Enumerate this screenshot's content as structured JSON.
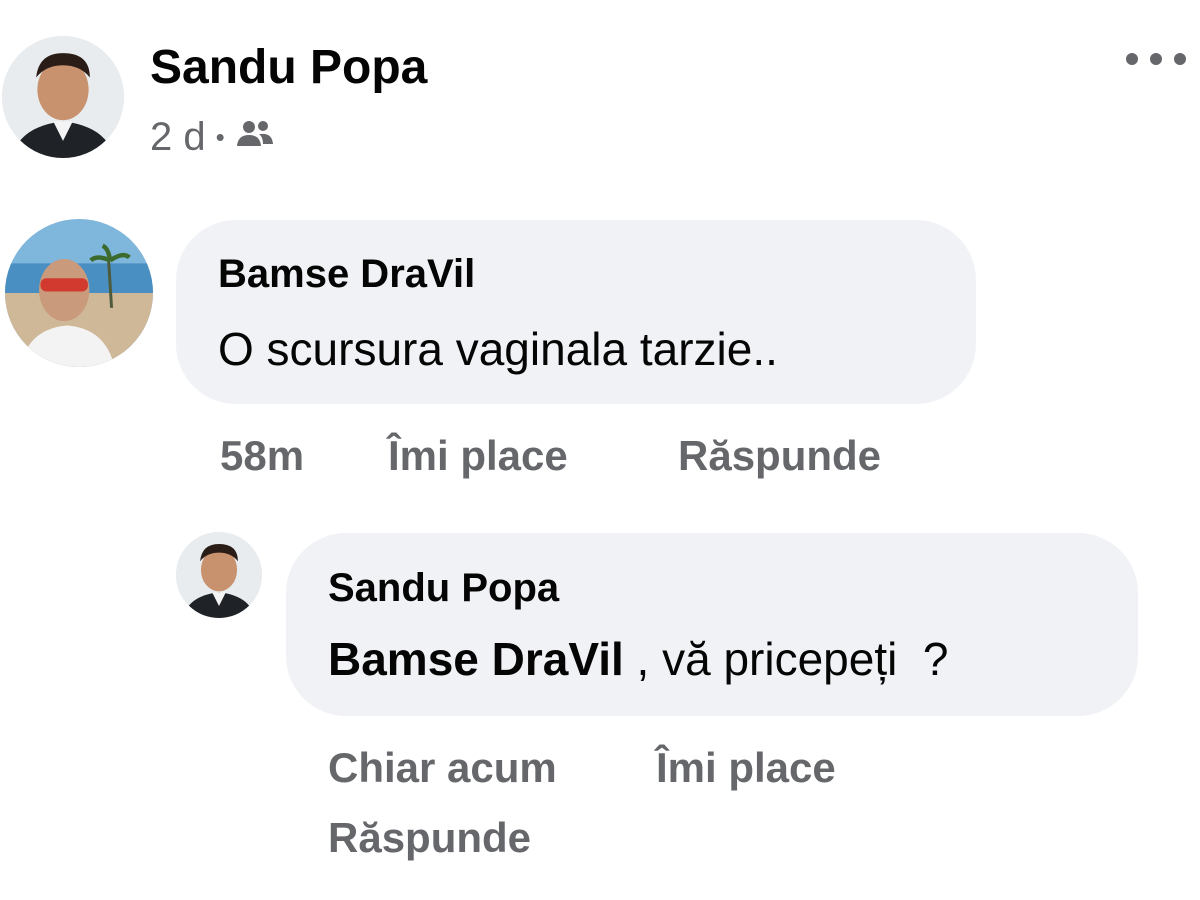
{
  "post": {
    "author": "Sandu Popa",
    "time": "2 d",
    "separator": "•",
    "audience_icon": "friends-icon",
    "more_icon": "more-options-icon"
  },
  "comments": [
    {
      "author": "Bamse DraVil",
      "text": "O scursura vaginala tarzie..",
      "time": "58m",
      "like_label": "Îmi place",
      "reply_label": "Răspunde"
    },
    {
      "author": "Sandu Popa",
      "mention": "Bamse DraVil",
      "text": " , vă pricepeți  ?",
      "time": "Chiar acum",
      "like_label": "Îmi place",
      "reply_label": "Răspunde"
    }
  ],
  "colors": {
    "bubble": "#f0f2f5",
    "secondary_text": "#65676b",
    "primary_text": "#050505"
  }
}
